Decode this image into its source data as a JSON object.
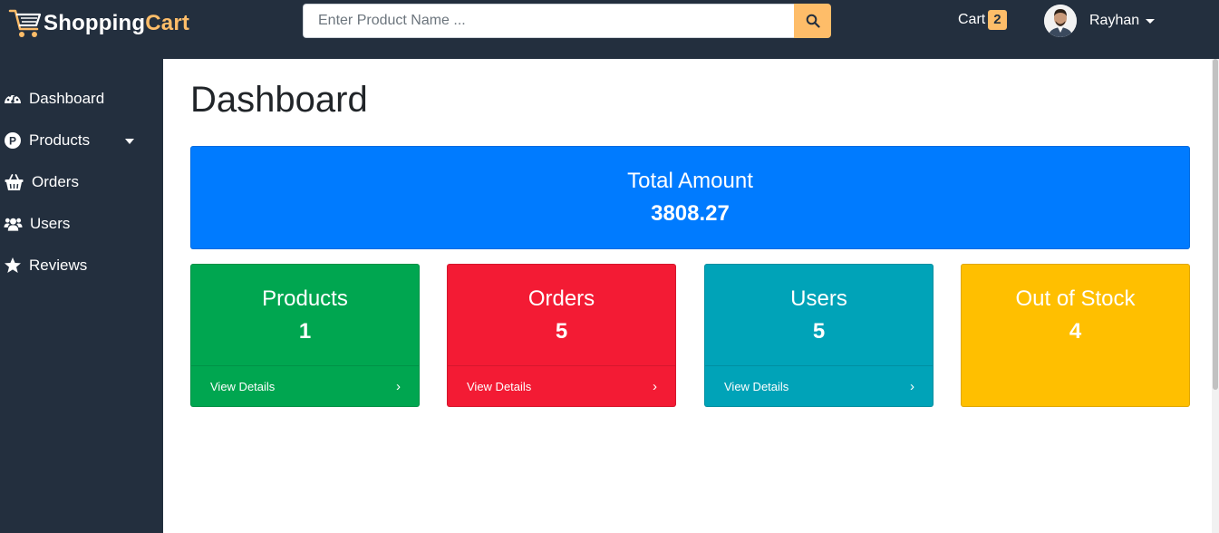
{
  "header": {
    "logo_part1": "Shopping",
    "logo_part2": "Cart",
    "search_placeholder": "Enter Product Name ...",
    "cart_label": "Cart",
    "cart_count": "2",
    "user_name": "Rayhan"
  },
  "sidebar": {
    "items": [
      {
        "label": "Dashboard",
        "icon": "tachometer-icon"
      },
      {
        "label": "Products",
        "icon": "product-p-icon"
      },
      {
        "label": "Orders",
        "icon": "basket-icon"
      },
      {
        "label": "Users",
        "icon": "users-icon"
      },
      {
        "label": "Reviews",
        "icon": "star-icon"
      }
    ]
  },
  "main": {
    "title": "Dashboard",
    "total": {
      "label": "Total Amount",
      "value": "3808.27"
    },
    "cards": [
      {
        "label": "Products",
        "value": "1",
        "link": "View Details"
      },
      {
        "label": "Orders",
        "value": "5",
        "link": "View Details"
      },
      {
        "label": "Users",
        "value": "5",
        "link": "View Details"
      },
      {
        "label": "Out of Stock",
        "value": "4"
      }
    ]
  },
  "colors": {
    "header_bg": "#232f3e",
    "accent": "#febd69",
    "total": "#007bff",
    "products": "#00a650",
    "orders": "#f31b34",
    "users": "#00a3b8",
    "out_of_stock": "#ffbf00"
  }
}
